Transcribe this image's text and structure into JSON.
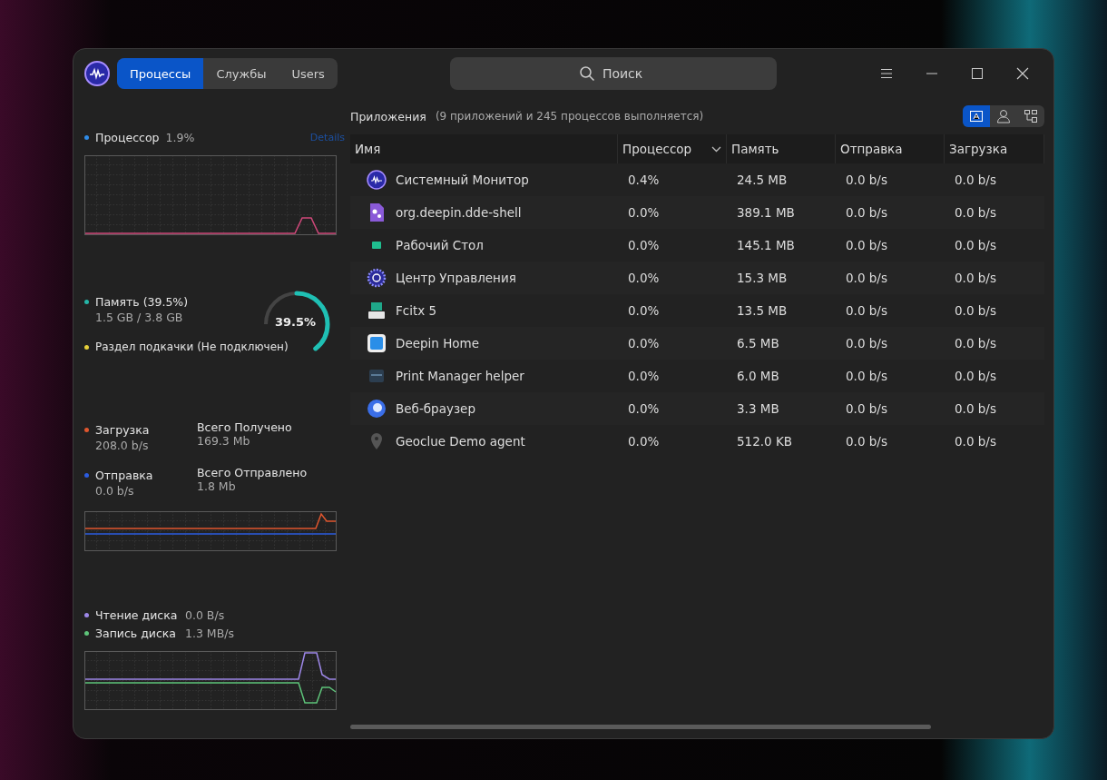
{
  "tabs": [
    {
      "label": "Процессы",
      "selected": true
    },
    {
      "label": "Службы",
      "selected": false
    },
    {
      "label": "Users",
      "selected": false
    }
  ],
  "search": {
    "placeholder": "Поиск"
  },
  "cpu": {
    "label": "Процессор",
    "value": "1.9%",
    "details": "Details"
  },
  "memory": {
    "label": "Память (39.5%)",
    "usage": "1.5 GB / 3.8 GB",
    "swap": "Раздел подкачки (Не подключен)",
    "percent": "39.5%",
    "level": 0.395
  },
  "network": [
    {
      "label": "Загрузка",
      "value": "208.0 b/s",
      "total_label": "Всего Получено",
      "total": "169.3 Mb",
      "color": "#e0562e"
    },
    {
      "label": "Отправка",
      "value": "0.0 b/s",
      "total_label": "Всего Отправлено",
      "total": "1.8 Mb",
      "color": "#2b5ce0"
    }
  ],
  "disk": [
    {
      "label": "Чтение диска",
      "value": "0.0 B/s",
      "color": "#9d87e8"
    },
    {
      "label": "Запись диска",
      "value": "1.3 MB/s",
      "color": "#5ec47a"
    }
  ],
  "section": {
    "title": "Приложения",
    "summary": "(9 приложений и 245 процессов выполняется)"
  },
  "view_buttons": [
    {
      "selected": true
    },
    {
      "selected": false
    },
    {
      "selected": false
    }
  ],
  "table": {
    "columns": [
      {
        "label": "Имя",
        "sorted": false
      },
      {
        "label": "Процессор",
        "sorted": true
      },
      {
        "label": "Память",
        "sorted": false
      },
      {
        "label": "Отправка",
        "sorted": false
      },
      {
        "label": "Загрузка",
        "sorted": false
      }
    ],
    "rows": [
      [
        "Системный Монитор",
        "0.4%",
        "24.5 MB",
        "0.0 b/s",
        "0.0 b/s"
      ],
      [
        "org.deepin.dde-shell",
        "0.0%",
        "389.1 MB",
        "0.0 b/s",
        "0.0 b/s"
      ],
      [
        "Рабочий Стол",
        "0.0%",
        "145.1 MB",
        "0.0 b/s",
        "0.0 b/s"
      ],
      [
        "Центр Управления",
        "0.0%",
        "15.3 MB",
        "0.0 b/s",
        "0.0 b/s"
      ],
      [
        "Fcitx 5",
        "0.0%",
        "13.5 MB",
        "0.0 b/s",
        "0.0 b/s"
      ],
      [
        "Deepin Home",
        "0.0%",
        "6.5 MB",
        "0.0 b/s",
        "0.0 b/s"
      ],
      [
        "Print Manager helper",
        "0.0%",
        "6.0 MB",
        "0.0 b/s",
        "0.0 b/s"
      ],
      [
        "Веб-браузер",
        "0.0%",
        "3.3 MB",
        "0.0 b/s",
        "0.0 b/s"
      ],
      [
        "Geoclue Demo agent",
        "0.0%",
        "512.0 KB",
        "0.0 b/s",
        "0.0 b/s"
      ]
    ]
  }
}
